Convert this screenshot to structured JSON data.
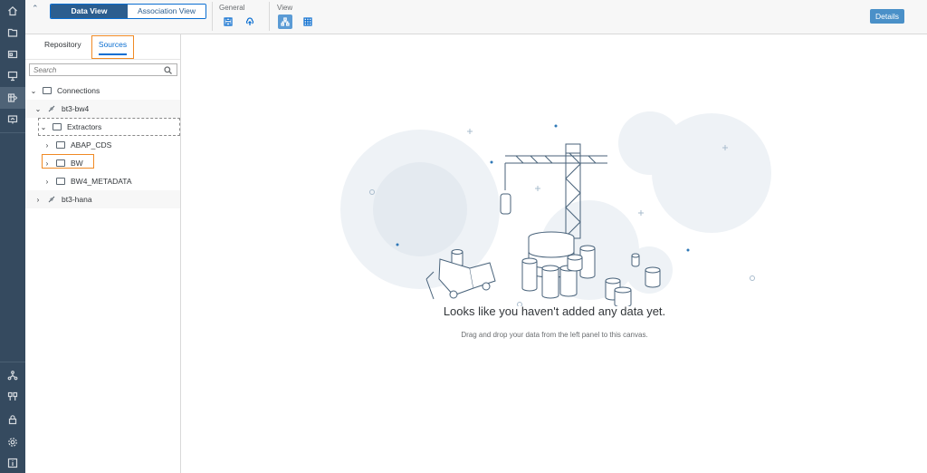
{
  "rail": {
    "items": [
      {
        "name": "home-icon"
      },
      {
        "name": "folder-icon"
      },
      {
        "name": "id-card-icon"
      },
      {
        "name": "presentation-icon"
      },
      {
        "name": "data-builder-icon",
        "active": true
      },
      {
        "name": "monitor-icon"
      },
      {
        "name": "network-icon"
      },
      {
        "name": "connections-icon"
      },
      {
        "name": "lock-icon"
      },
      {
        "name": "settings-icon"
      },
      {
        "name": "info-icon"
      }
    ]
  },
  "toolbar": {
    "view_toggle": {
      "data_view": "Data View",
      "association_view": "Association View",
      "selected": "data_view"
    },
    "general_label": "General",
    "view_label": "View",
    "details_label": "Details",
    "icons": {
      "save": "save-icon",
      "deploy": "upload-cloud-icon",
      "tree_view": "hierarchy-icon",
      "table_view": "grid-icon"
    }
  },
  "panel": {
    "tabs": {
      "repository": "Repository",
      "sources": "Sources",
      "active": "sources"
    },
    "search": {
      "placeholder": "Search",
      "value": ""
    },
    "tree": {
      "connections": "Connections",
      "bt3_bw4": "bt3-bw4",
      "extractors": "Extractors",
      "abap_cds": "ABAP_CDS",
      "bw": "BW",
      "bw4_metadata": "BW4_METADATA",
      "bt3_hana": "bt3-hana"
    }
  },
  "canvas": {
    "empty_title": "Looks like you haven't added any data yet.",
    "empty_subtitle": "Drag and drop your data from the left panel to this canvas."
  },
  "colors": {
    "rail": "#354a5f",
    "accent": "#0a6ed1",
    "highlight": "#f08a24",
    "selected_button": "#2c5e8f"
  }
}
